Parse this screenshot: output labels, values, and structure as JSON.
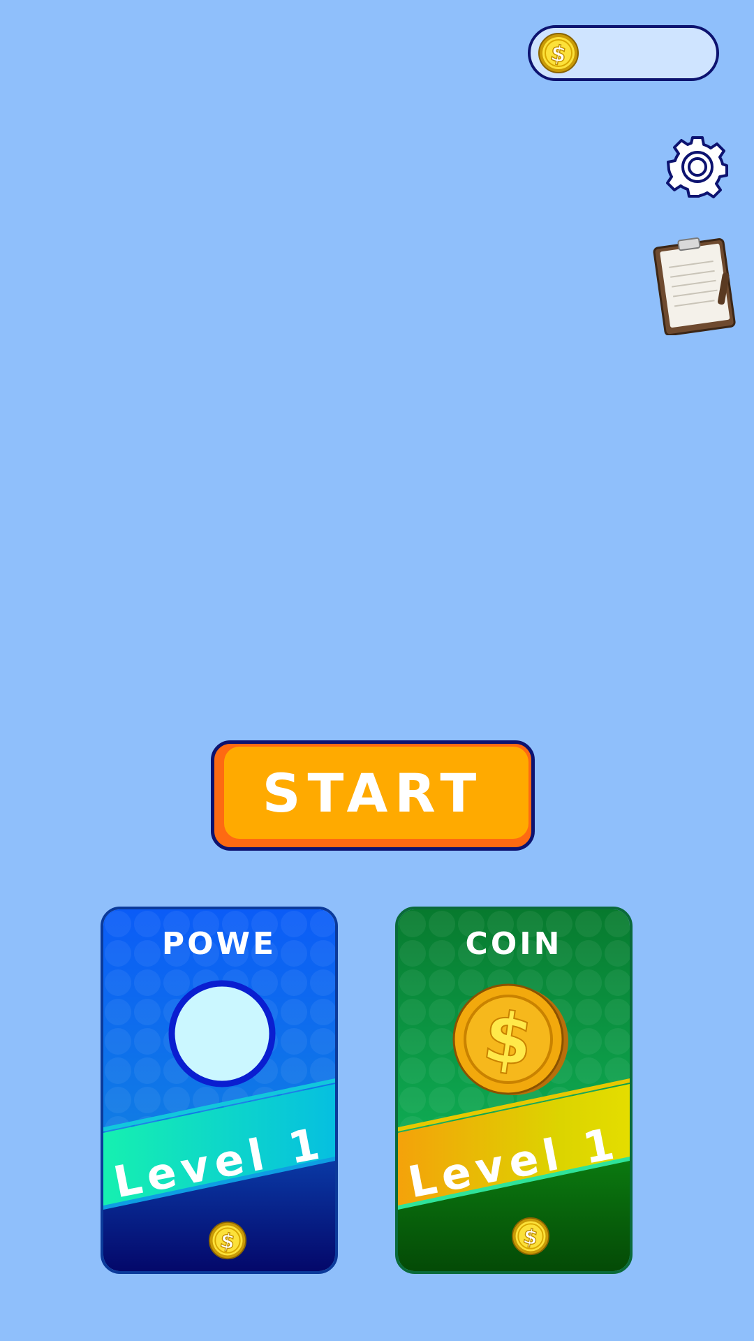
{
  "hud": {
    "coin_count": "",
    "coin_icon": "dollar-coin-icon",
    "settings_icon": "gear-icon",
    "tasks_icon": "clipboard-icon"
  },
  "start_button": {
    "label": "START"
  },
  "cards": [
    {
      "id": "power",
      "title": "POWE",
      "level_label": "Level 1",
      "icon": "power-orb-icon",
      "price_icon": "dollar-coin-icon",
      "color": "#0c55ec"
    },
    {
      "id": "coin",
      "title": "COIN",
      "level_label": "Level 1",
      "icon": "dollar-coin-icon",
      "price_icon": "dollar-coin-icon",
      "color": "#0a9a45"
    }
  ],
  "colors": {
    "background": "#8fbffb",
    "outline": "#0d1370",
    "start_button": "#ffaa00",
    "coin_gold": "#f5c518"
  }
}
